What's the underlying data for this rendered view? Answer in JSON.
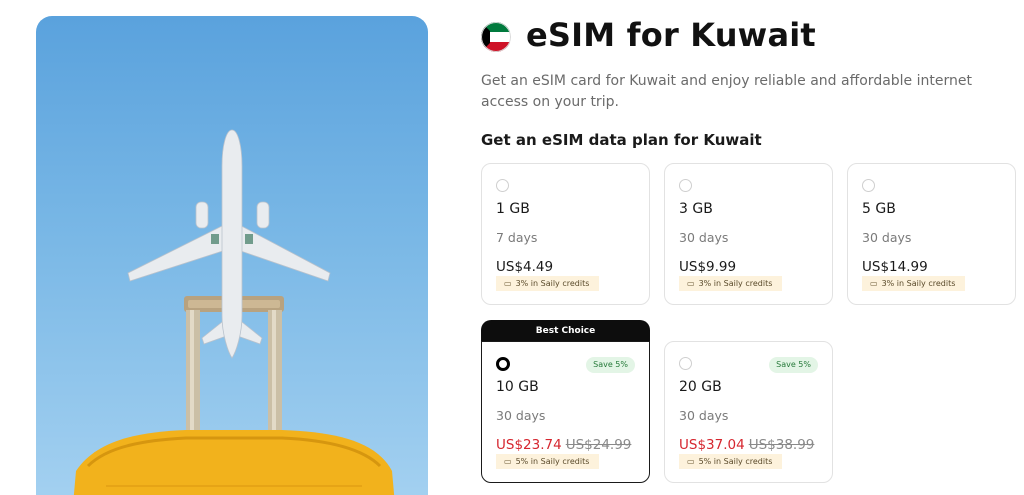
{
  "header": {
    "title": "eSIM for Kuwait",
    "description": "Get an eSIM card for Kuwait and enjoy reliable and affordable internet access on your trip.",
    "section_title": "Get an eSIM data plan for Kuwait",
    "flag_icon": "kuwait-flag-icon"
  },
  "colors": {
    "sale_price": "#d6262f",
    "save_badge_bg": "#e3f5e6",
    "credits_bg": "#fdf2dc",
    "best_choice_bg": "#0d0d0d"
  },
  "best_choice_label": "Best Choice",
  "plans": [
    {
      "data": "1 GB",
      "duration": "7 days",
      "price": "US$4.49",
      "old_price": "",
      "credits": "3% in Saily credits",
      "save": "",
      "selected": false
    },
    {
      "data": "3 GB",
      "duration": "30 days",
      "price": "US$9.99",
      "old_price": "",
      "credits": "3% in Saily credits",
      "save": "",
      "selected": false
    },
    {
      "data": "5 GB",
      "duration": "30 days",
      "price": "US$14.99",
      "old_price": "",
      "credits": "3% in Saily credits",
      "save": "",
      "selected": false
    },
    {
      "data": "10 GB",
      "duration": "30 days",
      "price": "US$23.74",
      "old_price": "US$24.99",
      "credits": "5% in Saily credits",
      "save": "Save 5%",
      "selected": true
    },
    {
      "data": "20 GB",
      "duration": "30 days",
      "price": "US$37.04",
      "old_price": "US$38.99",
      "credits": "5% in Saily credits",
      "save": "Save 5%",
      "selected": false
    }
  ]
}
